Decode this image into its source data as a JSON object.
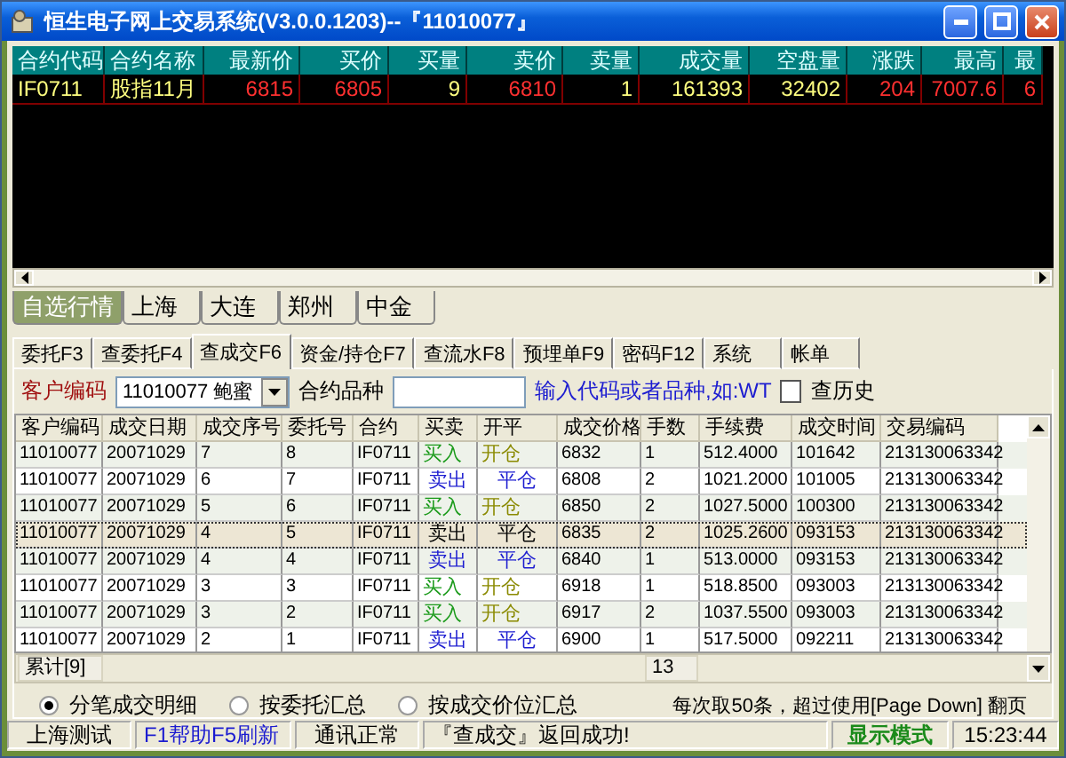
{
  "window": {
    "title": "恒生电子网上交易系统(V3.0.0.1203)--『11010077』"
  },
  "quotes": {
    "columns": [
      "合约代码",
      "合约名称",
      "最新价",
      "买价",
      "买量",
      "卖价",
      "卖量",
      "成交量",
      "空盘量",
      "涨跌",
      "最高",
      "最"
    ],
    "rows": [
      {
        "cells": [
          {
            "text": "IF0711",
            "color": "#ffff80"
          },
          {
            "text": "股指11月",
            "color": "#ffff80"
          },
          {
            "text": "6815",
            "color": "#ff3030"
          },
          {
            "text": "6805",
            "color": "#ff3030"
          },
          {
            "text": "9",
            "color": "#ffff80"
          },
          {
            "text": "6810",
            "color": "#ff3030"
          },
          {
            "text": "1",
            "color": "#ffff80"
          },
          {
            "text": "161393",
            "color": "#ffff80"
          },
          {
            "text": "32402",
            "color": "#ffff80"
          },
          {
            "text": "204",
            "color": "#ff3030"
          },
          {
            "text": "7007.6",
            "color": "#ff3030"
          },
          {
            "text": "6",
            "color": "#ff3030"
          }
        ]
      }
    ]
  },
  "market_tabs": [
    {
      "label": "自选行情",
      "selected": true
    },
    {
      "label": "上海",
      "selected": false
    },
    {
      "label": "大连",
      "selected": false
    },
    {
      "label": "郑州",
      "selected": false
    },
    {
      "label": "中金",
      "selected": false
    }
  ],
  "function_tabs": [
    {
      "label": "委托F3",
      "selected": false
    },
    {
      "label": "查委托F4",
      "selected": false
    },
    {
      "label": "查成交F6",
      "selected": true
    },
    {
      "label": "资金/持仓F7",
      "selected": false
    },
    {
      "label": "查流水F8",
      "selected": false
    },
    {
      "label": "预埋单F9",
      "selected": false
    },
    {
      "label": "密码F12",
      "selected": false
    },
    {
      "label": "系统",
      "selected": false
    },
    {
      "label": "帐单",
      "selected": false
    }
  ],
  "filter": {
    "customer_label": "客户编码",
    "customer_value": "11010077 鲍蜜",
    "contract_label": "合约品种",
    "hint": "输入代码或者品种,如:WT",
    "history_label": "查历史",
    "history_checked": false
  },
  "trades": {
    "columns": [
      "客户编码",
      "成交日期",
      "成交序号",
      "委托号",
      "合约",
      "买卖",
      "开平",
      "成交价格",
      "手数",
      "手续费",
      "成交时间",
      "交易编码"
    ],
    "rows": [
      {
        "selected": false,
        "kind": "buy",
        "cells": [
          "11010077",
          "20071029",
          "7",
          "8",
          "IF0711",
          "买入",
          "开仓",
          "6832",
          "1",
          "512.4000",
          "101642",
          "213130063342"
        ]
      },
      {
        "selected": false,
        "kind": "sell",
        "cells": [
          "11010077",
          "20071029",
          "6",
          "7",
          "IF0711",
          "卖出",
          "平仓",
          "6808",
          "2",
          "1021.2000",
          "101005",
          "213130063342"
        ]
      },
      {
        "selected": false,
        "kind": "buy",
        "cells": [
          "11010077",
          "20071029",
          "5",
          "6",
          "IF0711",
          "买入",
          "开仓",
          "6850",
          "2",
          "1027.5000",
          "100300",
          "213130063342"
        ]
      },
      {
        "selected": true,
        "kind": "sell",
        "cells": [
          "11010077",
          "20071029",
          "4",
          "5",
          "IF0711",
          "卖出",
          "平仓",
          "6835",
          "2",
          "1025.2600",
          "093153",
          "213130063342"
        ]
      },
      {
        "selected": false,
        "kind": "sell",
        "cells": [
          "11010077",
          "20071029",
          "4",
          "4",
          "IF0711",
          "卖出",
          "平仓",
          "6840",
          "1",
          "513.0000",
          "093153",
          "213130063342"
        ]
      },
      {
        "selected": false,
        "kind": "buy",
        "cells": [
          "11010077",
          "20071029",
          "3",
          "3",
          "IF0711",
          "买入",
          "开仓",
          "6918",
          "1",
          "518.8500",
          "093003",
          "213130063342"
        ]
      },
      {
        "selected": false,
        "kind": "buy",
        "cells": [
          "11010077",
          "20071029",
          "3",
          "2",
          "IF0711",
          "买入",
          "开仓",
          "6917",
          "2",
          "1037.5500",
          "093003",
          "213130063342"
        ]
      },
      {
        "selected": false,
        "kind": "sell",
        "cells": [
          "11010077",
          "20071029",
          "2",
          "1",
          "IF0711",
          "卖出",
          "平仓",
          "6900",
          "1",
          "517.5000",
          "092211",
          "213130063342"
        ]
      }
    ]
  },
  "summary": {
    "total": "累计[9]",
    "quantity": "13"
  },
  "modes": [
    {
      "label": "分笔成交明细",
      "selected": true
    },
    {
      "label": "按委托汇总",
      "selected": false
    },
    {
      "label": "按成交价位汇总",
      "selected": false
    }
  ],
  "paging_note": "每次取50条，超过使用[Page Down] 翻页",
  "status_bar": [
    {
      "text": "上海测试",
      "kind": "plain"
    },
    {
      "text": "F1帮助F5刷新",
      "kind": "help"
    },
    {
      "text": "通讯正常",
      "kind": "plain"
    },
    {
      "text": "『查成交』返回成功!",
      "kind": "message"
    },
    {
      "text": "显示模式",
      "kind": "mode"
    },
    {
      "text": "15:23:44",
      "kind": "clock"
    }
  ]
}
